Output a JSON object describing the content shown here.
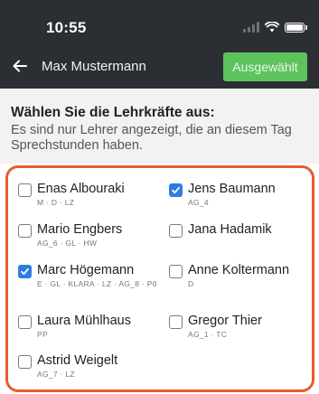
{
  "status": {
    "time": "10:55"
  },
  "header": {
    "title": "Max Mustermann",
    "select_button": "Ausgewählt"
  },
  "info": {
    "heading": "Wählen Sie die Lehrkräfte aus:",
    "text": "Es sind nur Lehrer angezeigt, die an diesem Tag Sprechstunden haben."
  },
  "teachers": [
    {
      "name": "Enas Albouraki",
      "tags": "M · D · LZ",
      "checked": false
    },
    {
      "name": "Jens Baumann",
      "tags": "AG_4",
      "checked": true
    },
    {
      "name": "Mario Engbers",
      "tags": "AG_6 · GL · HW",
      "checked": false
    },
    {
      "name": "Jana Hadamik",
      "tags": "",
      "checked": false
    },
    {
      "name": "Marc Högemann",
      "tags": "E · GL · KLARA · LZ · AG_8 · P0",
      "checked": true
    },
    {
      "name": "Anne Koltermann",
      "tags": "D",
      "checked": false
    },
    {
      "name": "Laura Mühlhaus",
      "tags": "PP",
      "checked": false
    },
    {
      "name": "Gregor Thier",
      "tags": "AG_1 · TC",
      "checked": false
    },
    {
      "name": "Astrid Weigelt",
      "tags": "AG_7 · LZ",
      "checked": false
    }
  ]
}
